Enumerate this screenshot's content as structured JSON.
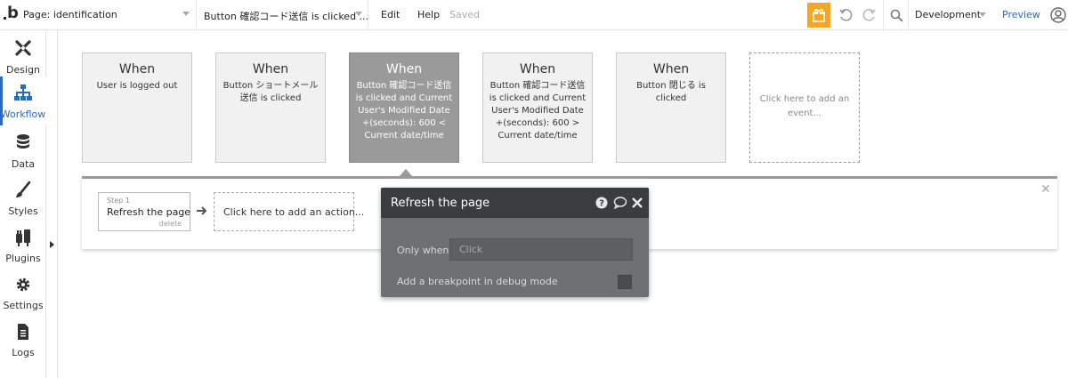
{
  "topbar": {
    "page_label": "Page: identification",
    "event_label": "Button 確認コード送信 is clicked ...",
    "menu": [
      "Edit",
      "Help"
    ],
    "saved_text": "Saved",
    "environment": "Development",
    "preview_label": "Preview"
  },
  "sidebar": {
    "items": [
      {
        "label": "Design",
        "icon": "design-icon"
      },
      {
        "label": "Workflow",
        "icon": "workflow-icon",
        "active": true
      },
      {
        "label": "Data",
        "icon": "database-icon"
      },
      {
        "label": "Styles",
        "icon": "brush-icon"
      },
      {
        "label": "Plugins",
        "icon": "plug-icon"
      },
      {
        "label": "Settings",
        "icon": "gear-icon"
      },
      {
        "label": "Logs",
        "icon": "document-icon"
      }
    ]
  },
  "events": [
    {
      "when": "When",
      "desc": "User is logged out"
    },
    {
      "when": "When",
      "desc": "Button ショートメール送信 is clicked"
    },
    {
      "when": "When",
      "desc": "Button 確認コード送信 is clicked and Current User's Modified Date +(seconds): 600 < Current date/time",
      "selected": true
    },
    {
      "when": "When",
      "desc": "Button 確認コード送信 is clicked and Current User's Modified Date +(seconds): 600 > Current date/time"
    },
    {
      "when": "When",
      "desc": "Button 閉じる is clicked"
    }
  ],
  "add_event_label": "Click here to add an event...",
  "actions": {
    "step_no": "Step 1",
    "step_title": "Refresh the page",
    "step_delete": "delete",
    "add_action_label": "Click here to add an action..."
  },
  "property_editor": {
    "title": "Refresh the page",
    "only_when_label": "Only when",
    "only_when_placeholder": "Click",
    "breakpoint_label": "Add a breakpoint in debug mode"
  },
  "colors": {
    "accent": "#2a6bbf",
    "gift": "#f6a623",
    "selected_event": "#9a9a9a",
    "editor_bg": "#6e7172",
    "editor_header": "#3a3d3e"
  }
}
